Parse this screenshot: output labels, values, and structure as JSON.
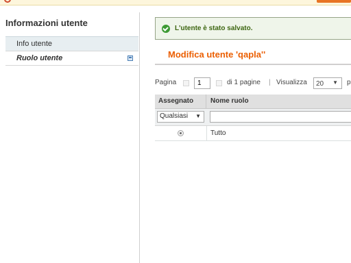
{
  "sidebar": {
    "title": "Informazioni utente",
    "tabs": [
      {
        "label": "Info utente"
      },
      {
        "label": "Ruolo utente"
      }
    ]
  },
  "message": {
    "success": "L'utente è stato salvato."
  },
  "page": {
    "title": "Modifica utente 'qapla''"
  },
  "pager": {
    "page_label": "Pagina",
    "page_value": "1",
    "of_pages": "di 1 pagine",
    "separator": "|",
    "view_label": "Visualizza",
    "per_page": "20",
    "trailing": "p"
  },
  "grid": {
    "columns": [
      "Assegnato",
      "Nome ruolo"
    ],
    "filter_select": "Qualsiasi",
    "rows": [
      {
        "assigned": true,
        "name": "Tutto"
      }
    ]
  },
  "colors": {
    "accent": "#eb5e00",
    "success_text": "#3d6611",
    "success_bg": "#eff5ea"
  }
}
